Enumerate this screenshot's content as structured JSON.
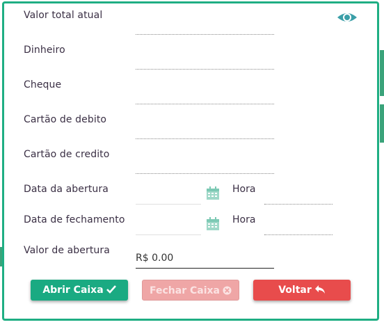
{
  "form": {
    "fields": [
      {
        "label": "Valor total atual"
      },
      {
        "label": "Dinheiro"
      },
      {
        "label": "Cheque"
      },
      {
        "label": "Cartão de debito"
      },
      {
        "label": "Cartão de credito"
      }
    ],
    "opening_date_label": "Data da abertura",
    "closing_date_label": "Data de fechamento",
    "time_label": "Hora",
    "opening_value_label": "Valor de abertura",
    "opening_value": "R$ 0.00"
  },
  "buttons": {
    "open": "Abrir Caixa",
    "close": "Fechar Caixa",
    "back": "Voltar"
  },
  "icons": {
    "visibility": "eye-icon",
    "calendar": "calendar-icon",
    "check": "check-icon",
    "x": "close-circle-icon",
    "back": "reply-arrow-icon"
  },
  "colors": {
    "accent": "#1fae83",
    "open_button": "#1aaa82",
    "close_button_disabled": "#efa6a6",
    "back_button": "#e84c4c"
  }
}
